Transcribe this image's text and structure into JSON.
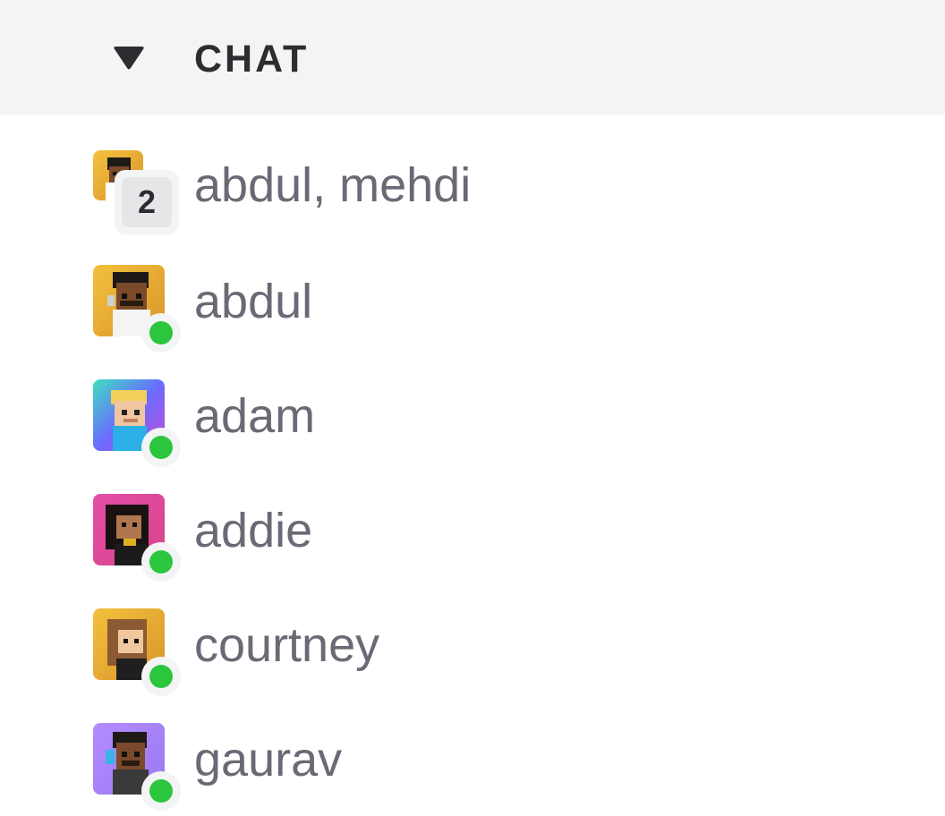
{
  "section": {
    "title": "CHAT",
    "caret_icon": "caret-down-icon"
  },
  "group_chat": {
    "name": "abdul, mehdi",
    "member_count": "2",
    "avatar_bg": [
      "#f3c13d",
      "#d9942a"
    ]
  },
  "contacts": [
    {
      "name": "abdul",
      "status": "online",
      "avatar_bg": [
        "#f3c13d",
        "#d9942a"
      ]
    },
    {
      "name": "adam",
      "status": "online",
      "avatar_bg": [
        "#3ee0c0",
        "#8b4dff"
      ]
    },
    {
      "name": "addie",
      "status": "online",
      "avatar_bg": [
        "#e34fa8",
        "#d94c8e"
      ]
    },
    {
      "name": "courtney",
      "status": "online",
      "avatar_bg": [
        "#f3c13d",
        "#d9942a"
      ]
    },
    {
      "name": "gaurav",
      "status": "online",
      "avatar_bg": [
        "#b38cff",
        "#9f7bff"
      ]
    }
  ],
  "colors": {
    "header_bg": "#f3f4f4",
    "name_text": "#696a75",
    "online": "#2bc63e"
  }
}
